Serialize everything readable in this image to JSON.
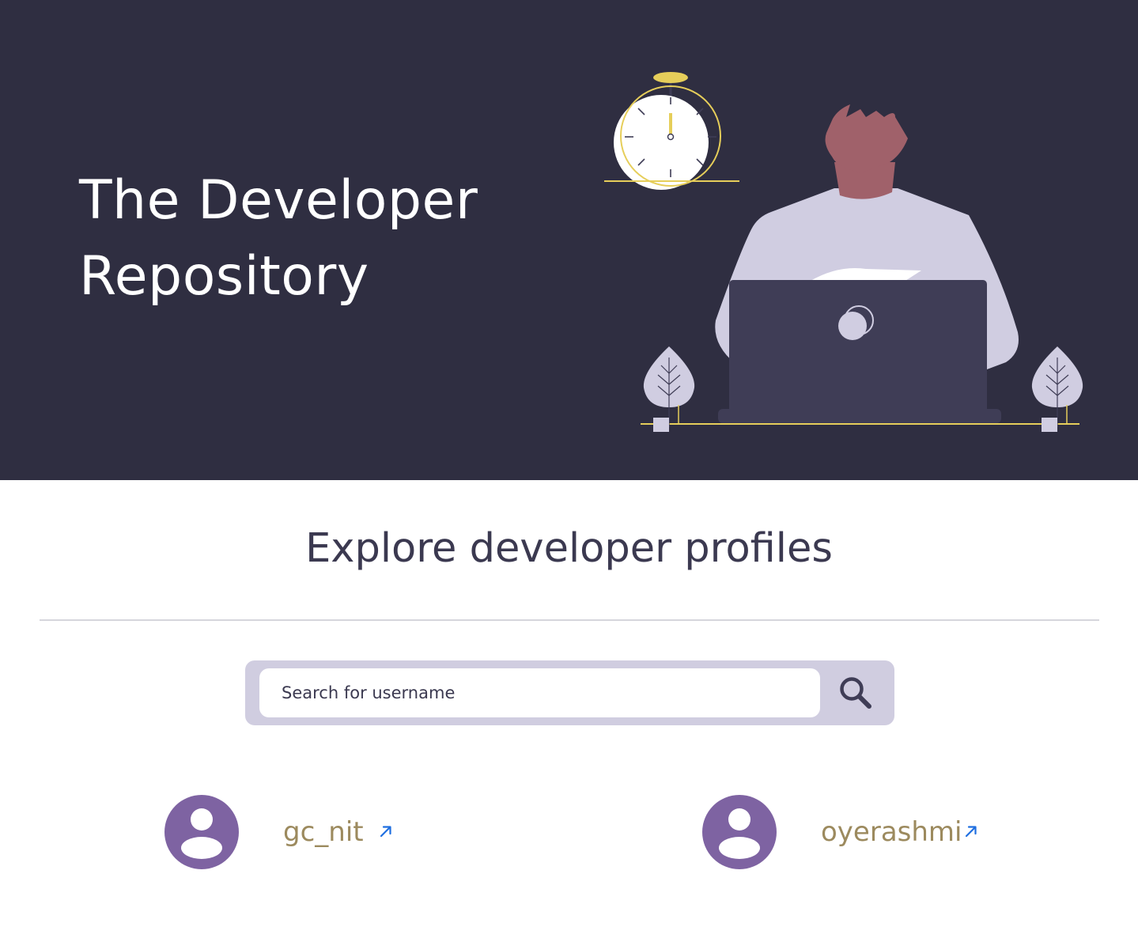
{
  "hero": {
    "title_line1": "The Developer",
    "title_line2": "Repository"
  },
  "main": {
    "heading": "Explore developer profiles",
    "search": {
      "placeholder": "Search for username",
      "value": ""
    },
    "profiles": [
      {
        "username": "gc_nit"
      },
      {
        "username": "oyerashmi"
      }
    ]
  },
  "colors": {
    "hero_background": "#2f2e41",
    "accent_yellow": "#e6ce5a",
    "avatar_purple": "#7e63a2",
    "username_color": "#9c8a5e",
    "link_blue": "#1f6fe0",
    "search_bar_bg": "#d0cde0"
  },
  "icons": {
    "search": "magnifier-icon",
    "avatar": "user-avatar-icon",
    "external_link": "arrow-up-right-icon"
  }
}
